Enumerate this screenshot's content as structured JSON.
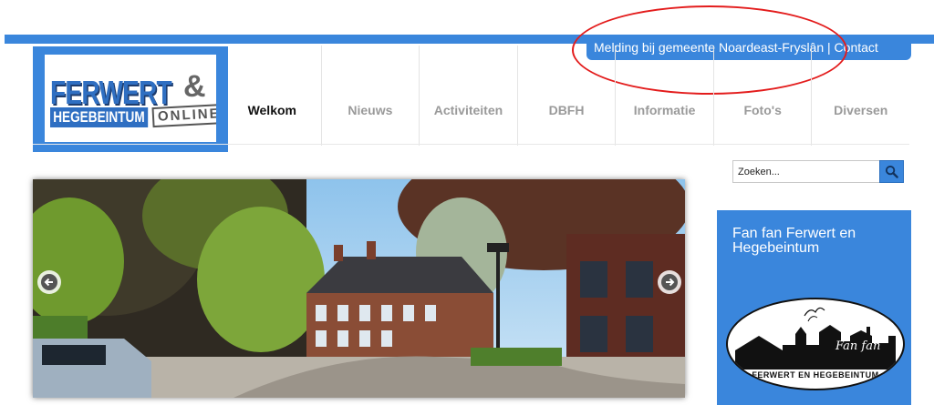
{
  "topbar": {
    "melding_label": "Melding bij gemeente Noardeast-Fryslân",
    "separator": "|",
    "contact_label": "Contact"
  },
  "logo": {
    "line1": "FERWERT",
    "amp": "&",
    "line2": "HEGEBEINTUM",
    "badge": "ONLINE"
  },
  "nav": {
    "items": [
      {
        "label": "Welkom"
      },
      {
        "label": "Nieuws"
      },
      {
        "label": "Activiteiten"
      },
      {
        "label": "DBFH"
      },
      {
        "label": "Informatie"
      },
      {
        "label": "Foto's"
      },
      {
        "label": "Diversen"
      }
    ]
  },
  "search": {
    "placeholder": "Zoeken..."
  },
  "fanbox": {
    "title": "Fan fan Ferwert en Hegebeintum",
    "logo_script": "Fan fan",
    "logo_caption": "FERWERT EN HEGEBEINTUM"
  },
  "colors": {
    "brand_blue": "#3a86dc",
    "annotation_red": "#e31c1c",
    "active_nav": "#111111",
    "inactive_nav": "#9a9a9a"
  },
  "icons": {
    "search": "magnifier-icon",
    "prev": "arrow-left-icon",
    "next": "arrow-right-icon"
  }
}
